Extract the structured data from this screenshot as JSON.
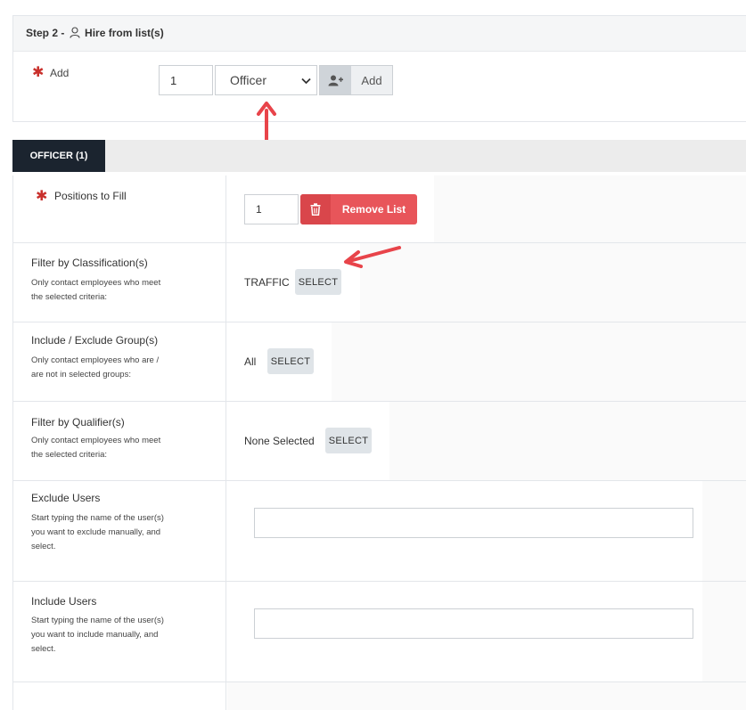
{
  "step": {
    "title_prefix": "Step 2 -",
    "title": "Hire from list(s)",
    "add_label": "Add",
    "add_quantity": "1",
    "list_select_value": "Officer",
    "add_button_label": "Add"
  },
  "tabs": [
    {
      "label": "OFFICER (1)",
      "active": true
    }
  ],
  "form": {
    "positions": {
      "label": "Positions to Fill",
      "quantity": "1",
      "remove_label": "Remove List"
    },
    "classification": {
      "label": "Filter by Classification(s)",
      "help_line1": "Only contact employees who meet",
      "help_line2": "the selected criteria:",
      "value": "TRAFFIC",
      "select_label": "SELECT"
    },
    "groups": {
      "label": "Include / Exclude Group(s)",
      "help_line1": "Only contact employees who are /",
      "help_line2": "are not in selected groups:",
      "value": "All",
      "select_label": "SELECT"
    },
    "qualifiers": {
      "label": "Filter by Qualifier(s)",
      "help_line1": "Only contact employees who meet",
      "help_line2": "the selected criteria:",
      "value": "None Selected",
      "select_label": "SELECT"
    },
    "exclude_users": {
      "label": "Exclude Users",
      "help_line1": "Start typing the name of the user(s)",
      "help_line2": "you want to exclude manually, and",
      "help_line3": "select.",
      "input_value": ""
    },
    "include_users": {
      "label": "Include Users",
      "help_line1": "Start typing the name of the user(s)",
      "help_line2": "you want to include manually, and",
      "help_line3": "select.",
      "input_value": ""
    }
  },
  "colors": {
    "required_star": "#c9302c",
    "tab_active_bg": "#1b242f",
    "remove_button": "#e8555a",
    "annotation_arrow": "#e8444a"
  }
}
